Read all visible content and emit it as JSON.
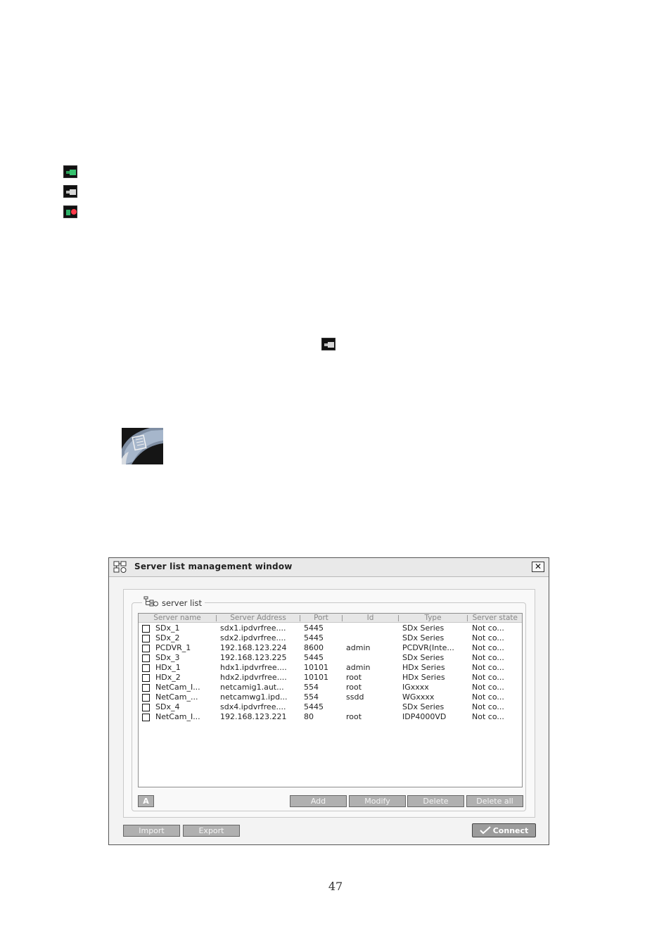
{
  "page_number": "47",
  "icons": [
    "camera-connected-icon",
    "camera-idle-icon",
    "camera-recording-icon",
    "camera-idle-icon",
    "server-list-knob-icon"
  ],
  "window": {
    "title": "Server list management window",
    "close_label": "✕",
    "group_label": "server list",
    "columns": [
      "Server name",
      "Server Address",
      "Port",
      "Id",
      "Type",
      "Server state"
    ],
    "rows": [
      {
        "name": "SDx_1",
        "address": "sdx1.ipdvrfree....",
        "port": "5445",
        "id": "",
        "type": "SDx Series",
        "state": "Not co..."
      },
      {
        "name": "SDx_2",
        "address": "sdx2.ipdvrfree....",
        "port": "5445",
        "id": "",
        "type": "SDx Series",
        "state": "Not co..."
      },
      {
        "name": "PCDVR_1",
        "address": "192.168.123.224",
        "port": "8600",
        "id": "admin",
        "type": "PCDVR(Inte...",
        "state": "Not co..."
      },
      {
        "name": "SDx_3",
        "address": "192.168.123.225",
        "port": "5445",
        "id": "",
        "type": "SDx Series",
        "state": "Not co..."
      },
      {
        "name": "HDx_1",
        "address": "hdx1.ipdvrfree....",
        "port": "10101",
        "id": "admin",
        "type": "HDx Series",
        "state": "Not co..."
      },
      {
        "name": "HDx_2",
        "address": "hdx2.ipdvrfree....",
        "port": "10101",
        "id": "root",
        "type": "HDx Series",
        "state": "Not co..."
      },
      {
        "name": "NetCam_I...",
        "address": "netcamig1.aut...",
        "port": "554",
        "id": "root",
        "type": "IGxxxx",
        "state": "Not co..."
      },
      {
        "name": "NetCam_...",
        "address": "netcamwg1.ipd...",
        "port": "554",
        "id": "ssdd",
        "type": "WGxxxx",
        "state": "Not co..."
      },
      {
        "name": "SDx_4",
        "address": "sdx4.ipdvrfree....",
        "port": "5445",
        "id": "",
        "type": "SDx Series",
        "state": "Not co..."
      },
      {
        "name": "NetCam_I...",
        "address": "192.168.123.221",
        "port": "80",
        "id": "root",
        "type": "IDP4000VD",
        "state": "Not co..."
      }
    ],
    "buttons": {
      "select_all": "A",
      "add": "Add",
      "modify": "Modify",
      "delete": "Delete",
      "delete_all": "Delete all",
      "import": "Import",
      "export": "Export",
      "connect": "Connect"
    }
  }
}
